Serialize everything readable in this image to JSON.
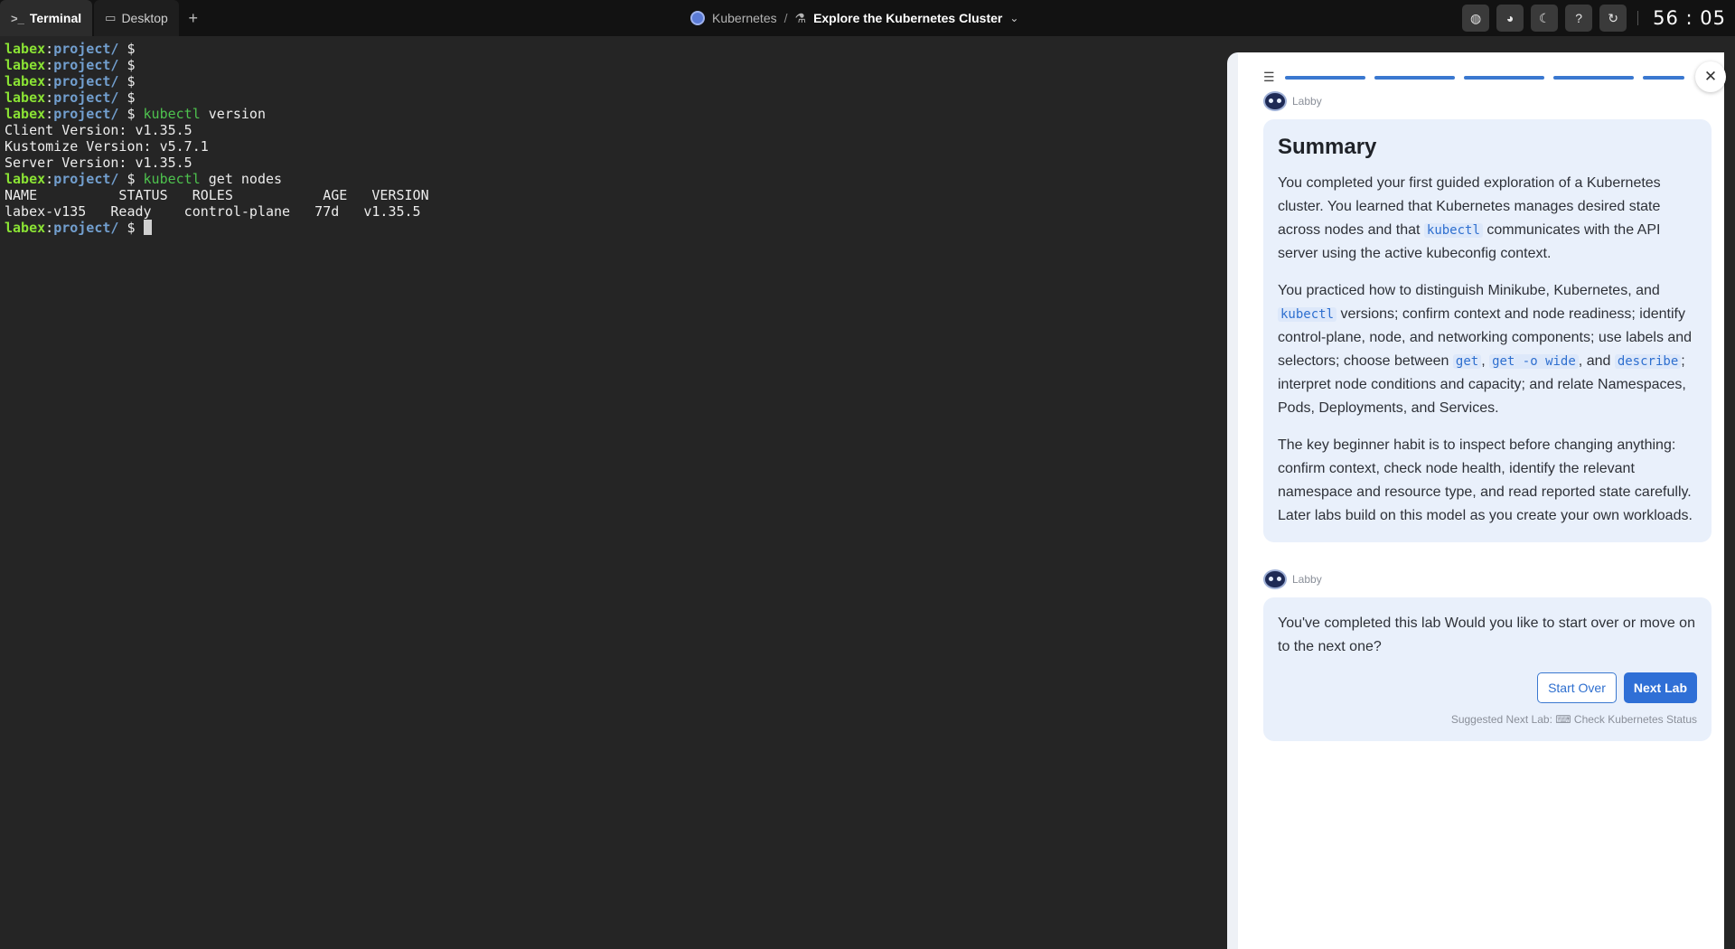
{
  "tabs": [
    {
      "label": "Terminal",
      "icon": "terminal-icon"
    },
    {
      "label": "Desktop",
      "icon": "monitor-icon"
    }
  ],
  "add_tab_icon": "plus-icon",
  "breadcrumb": {
    "course": "Kubernetes",
    "separator": "/",
    "lab_title": "Explore the Kubernetes Cluster"
  },
  "toolbar": {
    "icons": [
      "globe-icon",
      "discord-icon",
      "moon-icon",
      "help-icon",
      "refresh-icon"
    ],
    "timer": "56 : 05"
  },
  "terminal": {
    "user": "labex",
    "path": "project/",
    "lines": {
      "l5_cmd": "kubectl",
      "l5_args": " version",
      "l6": "Client Version: v1.35.5",
      "l7": "Kustomize Version: v5.7.1",
      "l8": "Server Version: v1.35.5",
      "l9_cmd": "kubectl",
      "l9_args": " get nodes",
      "l10": "NAME          STATUS   ROLES           AGE   VERSION",
      "l11": "labex-v135   Ready    control-plane   77d   v1.35.5"
    }
  },
  "panel": {
    "sender": "Labby",
    "summary": {
      "heading": "Summary",
      "p1_a": "You completed your first guided exploration of a Kubernetes cluster. You learned that Kubernetes manages desired state across nodes and that ",
      "p1_code": "kubectl",
      "p1_b": " communicates with the API server using the active kubeconfig context.",
      "p2_a": "You practiced how to distinguish Minikube, Kubernetes, and ",
      "p2_code1": "kubectl",
      "p2_b": " versions; confirm context and node readiness; identify control-plane, node, and networking components; use labels and selectors; choose between ",
      "p2_code2": "get",
      "p2_c": ", ",
      "p2_code3": "get -o wide",
      "p2_d": ", and ",
      "p2_code4": "describe",
      "p2_e": "; interpret node conditions and capacity; and relate Namespaces, Pods, Deployments, and Services.",
      "p3": "The key beginner habit is to inspect before changing anything: confirm context, check node health, identify the relevant namespace and resource type, and read reported state carefully. Later labs build on this model as you create your own workloads."
    },
    "completion": {
      "message": "You've completed this lab Would you like to start over or move on to the next one?",
      "start_over": "Start Over",
      "next_lab": "Next Lab",
      "suggested_label": "Suggested Next Lab:",
      "suggested_lab": "Check Kubernetes Status"
    }
  }
}
